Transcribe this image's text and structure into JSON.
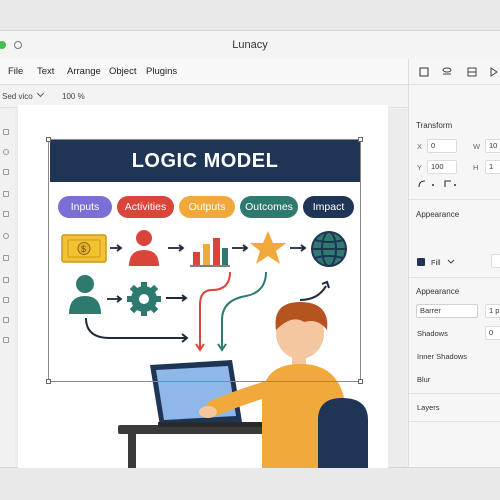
{
  "window": {
    "title": "Lunacy"
  },
  "menu": [
    "File",
    "Text",
    "Arrange",
    "Object",
    "Plugins"
  ],
  "toolbar": {
    "font_name": "Sed vico",
    "zoom": "100 %"
  },
  "logic_model": {
    "title": "LOGIC MODEL",
    "stages": [
      {
        "label": "Inputs",
        "color": "#7b6fd6"
      },
      {
        "label": "Activities",
        "color": "#d9453b"
      },
      {
        "label": "Outputs",
        "color": "#f2a93b"
      },
      {
        "label": "Outcomes",
        "color": "#2f7a6e"
      },
      {
        "label": "Impact",
        "color": "#1e3556"
      }
    ]
  },
  "right_panel": {
    "transform": "Transform",
    "x_label": "X",
    "x_value": "0",
    "w_label": "W",
    "w_value": "10",
    "y_label": "Y",
    "y_value": "100",
    "h_label": "H",
    "h_value": "1",
    "appearance": "Appearance",
    "fill_label": "Fill",
    "appearance2": "Appearance",
    "stroke_label": "Barrer",
    "stroke_value": "1 p",
    "shadows": "Shadows",
    "shadows_value": "0",
    "inner_shadows": "Inner Shadows",
    "blur": "Blur",
    "layers": "Layers"
  }
}
